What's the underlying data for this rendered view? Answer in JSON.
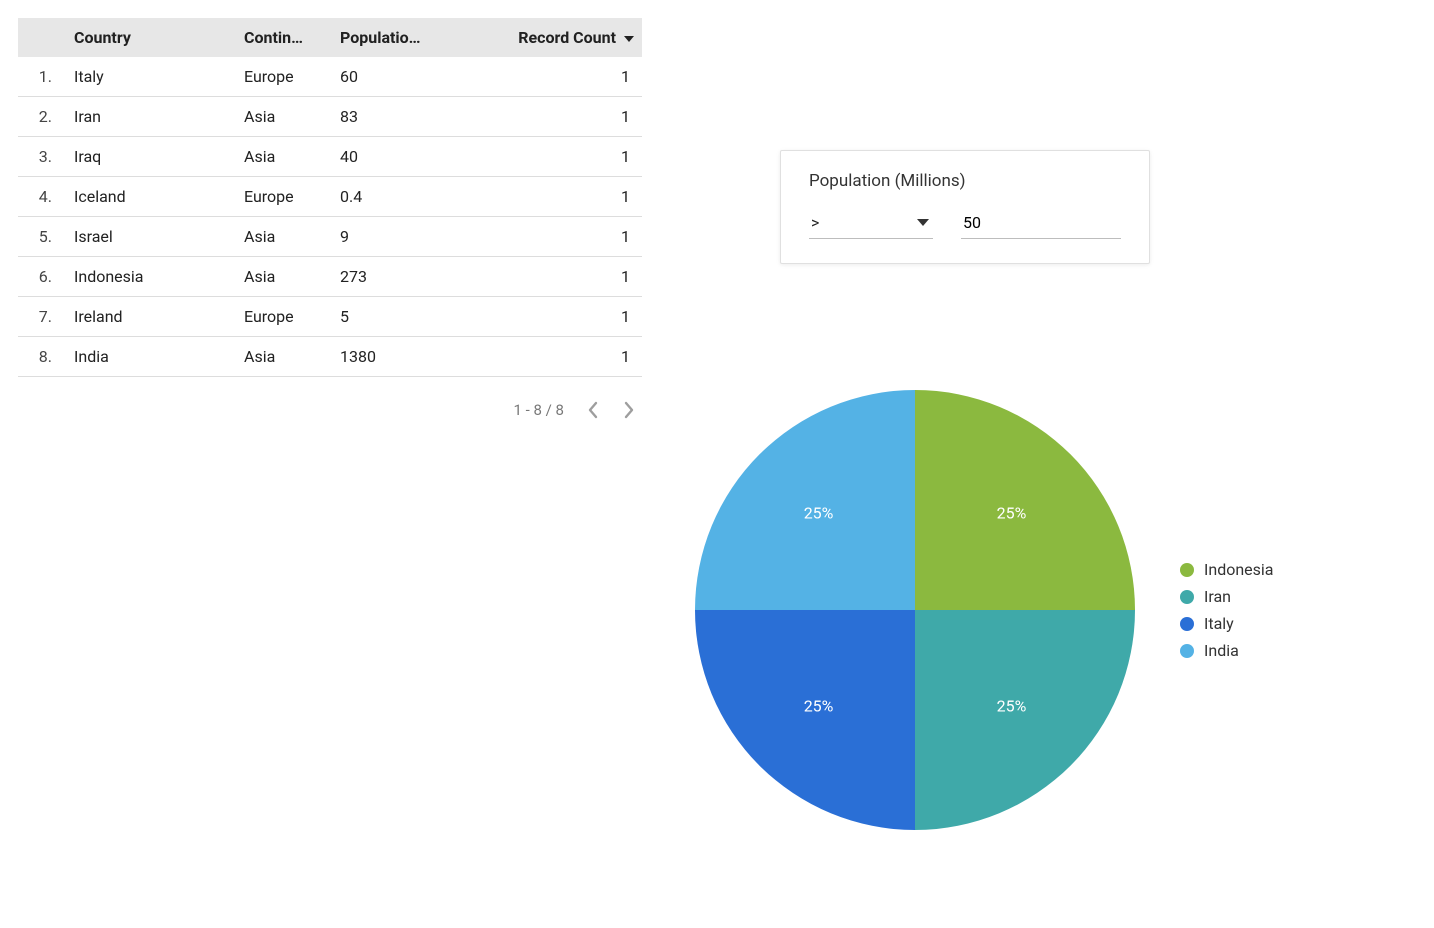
{
  "table": {
    "headers": {
      "idx": "",
      "country": "Country",
      "continent": "Contin…",
      "population": "Populatio…",
      "record": "Record Count"
    },
    "rows": [
      {
        "n": "1.",
        "country": "Italy",
        "continent": "Europe",
        "population": "60",
        "record": "1"
      },
      {
        "n": "2.",
        "country": "Iran",
        "continent": "Asia",
        "population": "83",
        "record": "1"
      },
      {
        "n": "3.",
        "country": "Iraq",
        "continent": "Asia",
        "population": "40",
        "record": "1"
      },
      {
        "n": "4.",
        "country": "Iceland",
        "continent": "Europe",
        "population": "0.4",
        "record": "1"
      },
      {
        "n": "5.",
        "country": "Israel",
        "continent": "Asia",
        "population": "9",
        "record": "1"
      },
      {
        "n": "6.",
        "country": "Indonesia",
        "continent": "Asia",
        "population": "273",
        "record": "1"
      },
      {
        "n": "7.",
        "country": "Ireland",
        "continent": "Europe",
        "population": "5",
        "record": "1"
      },
      {
        "n": "8.",
        "country": "India",
        "continent": "Asia",
        "population": "1380",
        "record": "1"
      }
    ],
    "pager": "1 - 8 / 8"
  },
  "filter": {
    "title": "Population (Millions)",
    "operator": ">",
    "value": "50"
  },
  "chart_data": {
    "type": "pie",
    "title": "",
    "series": [
      {
        "name": "Indonesia",
        "value": 25,
        "label": "25%",
        "color": "#8bb93f"
      },
      {
        "name": "Iran",
        "value": 25,
        "label": "25%",
        "color": "#3fa9a9"
      },
      {
        "name": "Italy",
        "value": 25,
        "label": "25%",
        "color": "#2a6fd6"
      },
      {
        "name": "India",
        "value": 25,
        "label": "25%",
        "color": "#54b2e5"
      }
    ],
    "legend_position": "right"
  }
}
